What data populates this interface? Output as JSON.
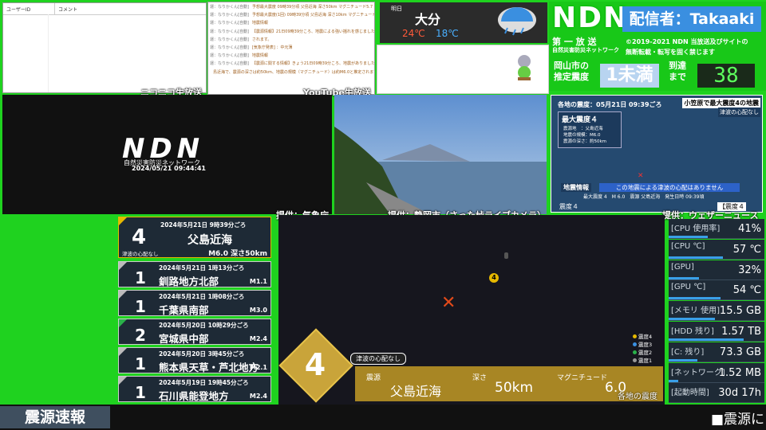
{
  "comments_panel": {
    "col_user": "ユーザーID",
    "col_comment": "コメント"
  },
  "messages": [
    {
      "user": "運：なりかくん[自動]",
      "text": "予想最大震度 09時39分頃 父島近海 深さ50km マグニチュード5.7 予想震度4"
    },
    {
      "user": "運：なりかくん[自動]",
      "text": "予想最大震度(1回) 09時39分頃 父島近海 深さ10km マグニチュード5.7 予想震度4"
    },
    {
      "user": "運：なりかくん[自動]",
      "text": "地震情報"
    },
    {
      "user": "運：なりかくん[自動]",
      "text": "【震源情報】21日09時39分ころ、地震による強い揺れを感じました。今後の情報に注意してください。震央震源は4と推定"
    },
    {
      "user": "運：なりかくん[自動]",
      "text": "されます。"
    },
    {
      "user": "運：なりかくん[自動]",
      "text": "[気象庁発表] ：中元薄"
    },
    {
      "user": "運：なりかくん[自動]",
      "text": "地震情報"
    },
    {
      "user": "運：なりかくん[自動]",
      "text": "【震源に関する情報】きょう21日09時39分ころ、地震がありました。この地震による津波の心配はありません。震源地は父"
    },
    {
      "user": "",
      "text": "島近海で、震源の深さは約50km、地震の規模（マグニチュード）は約M6.0と推定されます。"
    }
  ],
  "captions": {
    "niconico": "ニコニコ生放送",
    "youtube": "YouTube生放送",
    "jma": "提供：気象庁",
    "shizuoka": "提供：静岡市（さった峠ライブカメラ）",
    "weathernews": "提供：ウェザーニュース"
  },
  "weather": {
    "day": "明日",
    "city": "大分",
    "high": "24℃",
    "low": "18℃"
  },
  "header": {
    "logo": "NDN",
    "broadcaster": "配信者：Takaaki",
    "first_broadcast": "第 一 放 送",
    "org": "自然災害防災ネットワーク",
    "copyright_1": "©2019-2021 NDN 当放送及びサイトの",
    "copyright_2": "無断転載・転写を固く禁じます",
    "city_label_1": "岡山市の",
    "city_label_2": "推定震度",
    "estimated_intensity": "1未満",
    "arrival_label_1": "到達",
    "arrival_label_2": "まで",
    "arrival_seconds": "38"
  },
  "ndn_screen": {
    "logo": "NDN",
    "sub": "自然災害防災ネットワーク",
    "datetime": "2024/05/21 09:44:41"
  },
  "tv": {
    "header": "各地の震度：05月21日 09:39ごろ",
    "headline_1": "小笠原で最大震度4の地震",
    "headline_2": "津波の心配なし",
    "max_label": "最大震度４",
    "src": "震源地　：父島近海",
    "mag": "地震の規模：M6.0",
    "depth": "震源の深さ：約50km",
    "info_label": "地震情報",
    "info_text": "この地震による津波の心配はありません",
    "ticker": "最大震度 4　M 6.0　震源 父島近海　発生日時 09:39頃",
    "bottom_left": "震度４",
    "bottom_right": "【震度４"
  },
  "eq_main": {
    "intensity": "4",
    "time": "2024年5月21日 9時39分ごろ",
    "location": "父島近海",
    "tsunami": "津波の心配なし",
    "mag_depth": "M6.0 深さ50km"
  },
  "eq_list": [
    {
      "intensity": "1",
      "time": "2024年5月21日 1時13分ごろ",
      "location": "釧路地方北部",
      "mag": "M1.1"
    },
    {
      "intensity": "1",
      "time": "2024年5月21日 1時08分ごろ",
      "location": "千葉県南部",
      "mag": "M3.0"
    },
    {
      "intensity": "2",
      "time": "2024年5月20日 10時29分ごろ",
      "location": "宮城県中部",
      "mag": "M2.4"
    },
    {
      "intensity": "1",
      "time": "2024年5月20日 3時45分ごろ",
      "location": "熊本県天草・芦北地方",
      "mag": "M2.1"
    },
    {
      "intensity": "1",
      "time": "2024年5月19日 19時45分ごろ",
      "location": "石川県能登地方",
      "mag": "M2.4"
    }
  ],
  "map": {
    "legend": [
      "震度4",
      "震度3",
      "震度2",
      "震度1"
    ],
    "legend_colors": [
      "#e6b800",
      "#3a8fe0",
      "#2ab24a",
      "#999999"
    ],
    "marker_intensity": "4",
    "big_intensity": "4",
    "tsunami": "津波の心配なし",
    "label_src": "震源",
    "src": "父島近海",
    "label_depth": "深さ",
    "depth": "50km",
    "label_mag": "マグニチュード",
    "mag": "6.0",
    "caption": "各地の震度"
  },
  "stats": [
    {
      "label": "[CPU 使用率]",
      "value": "41%",
      "fill": 0.41
    },
    {
      "label": "[CPU ℃]",
      "value": "57 ℃",
      "fill": 0.57
    },
    {
      "label": "[GPU]",
      "value": "32%",
      "fill": 0.32
    },
    {
      "label": "[GPU ℃]",
      "value": "54 ℃",
      "fill": 0.54
    },
    {
      "label": "[メモリ 使用]",
      "value": "15.5 GB",
      "fill": 0.48
    },
    {
      "label": "[HDD 残り]",
      "value": "1.57 TB",
      "fill": 0.78
    },
    {
      "label": "[C: 残り]",
      "value": "73.3 GB",
      "fill": 0.3
    },
    {
      "label": "[ネットワーク]",
      "value": "1.52 MB",
      "fill": 0.1
    },
    {
      "label": "[起動時間]",
      "value": "30d 17h",
      "fill": 0
    }
  ],
  "footer": {
    "title": "震源速報",
    "ticker": "■震源に"
  }
}
